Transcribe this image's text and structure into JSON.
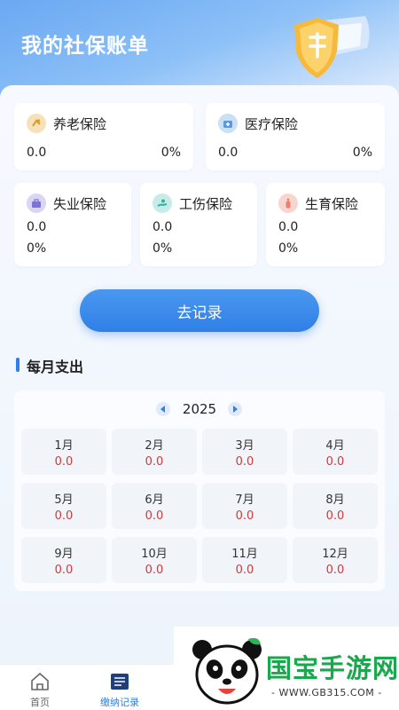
{
  "header": {
    "title": "我的社保账单"
  },
  "insurance": {
    "pension": {
      "name": "养老保险",
      "amount": "0.0",
      "percent": "0%"
    },
    "medical": {
      "name": "医疗保险",
      "amount": "0.0",
      "percent": "0%"
    },
    "unemployment": {
      "name": "失业保险",
      "amount": "0.0",
      "percent": "0%"
    },
    "injury": {
      "name": "工伤保险",
      "amount": "0.0",
      "percent": "0%"
    },
    "maternity": {
      "name": "生育保险",
      "amount": "0.0",
      "percent": "0%"
    }
  },
  "record_button": "去记录",
  "monthly": {
    "title": "每月支出",
    "year": "2025",
    "months": [
      {
        "name": "1月",
        "value": "0.0"
      },
      {
        "name": "2月",
        "value": "0.0"
      },
      {
        "name": "3月",
        "value": "0.0"
      },
      {
        "name": "4月",
        "value": "0.0"
      },
      {
        "name": "5月",
        "value": "0.0"
      },
      {
        "name": "6月",
        "value": "0.0"
      },
      {
        "name": "7月",
        "value": "0.0"
      },
      {
        "name": "8月",
        "value": "0.0"
      },
      {
        "name": "9月",
        "value": "0.0"
      },
      {
        "name": "10月",
        "value": "0.0"
      },
      {
        "name": "11月",
        "value": "0.0"
      },
      {
        "name": "12月",
        "value": "0.0"
      }
    ]
  },
  "tabbar": {
    "home": {
      "label": "首页",
      "icon": "home-icon"
    },
    "records": {
      "label": "缴纳记录",
      "icon": "list-icon"
    }
  },
  "watermark": {
    "brand": "国宝手游网",
    "url": "- WWW.GB315.COM -"
  },
  "colors": {
    "accent": "#2f7fe6",
    "value_red": "#d23a3a"
  }
}
